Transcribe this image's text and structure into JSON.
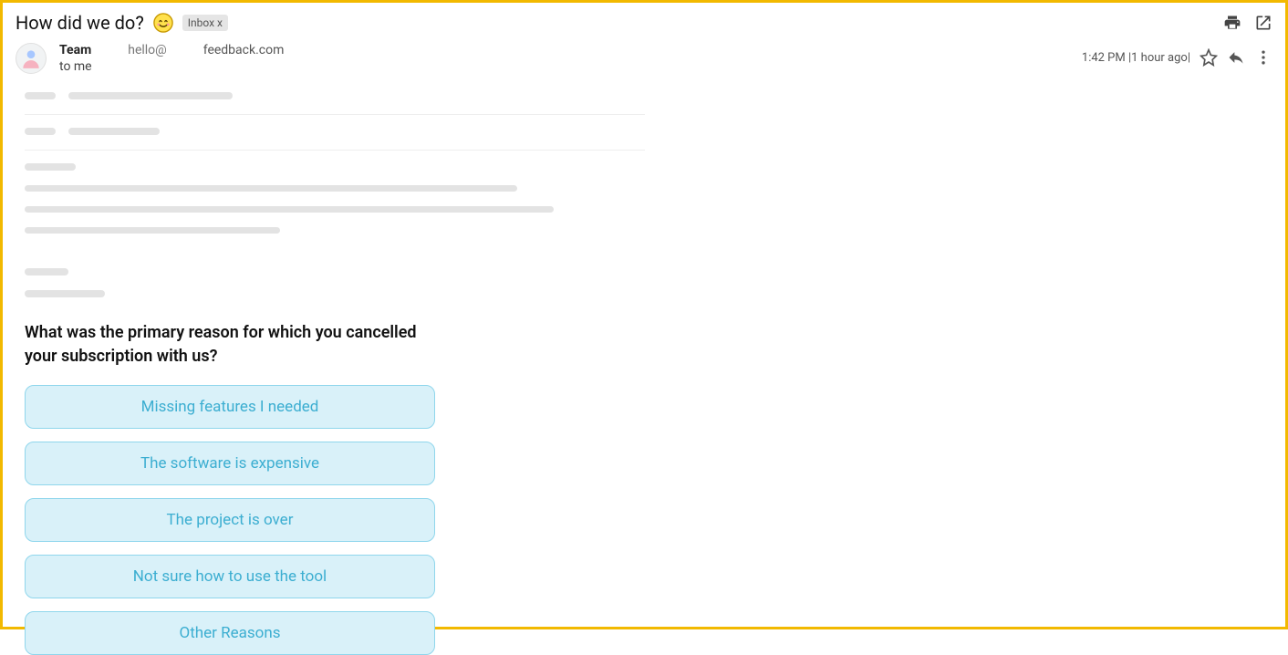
{
  "header": {
    "subject": "How did we do?",
    "label": "Inbox x"
  },
  "sender": {
    "name": "Team",
    "addr_user": "hello@",
    "addr_domain": "feedback.com",
    "to_line": "to me"
  },
  "meta": {
    "time": "1:42 PM |1 hour ago|"
  },
  "survey": {
    "question": "What was the primary reason for which you cancelled your subscription with us?",
    "options": [
      "Missing features I needed",
      "The software is expensive",
      "The project is over",
      "Not sure how to use the tool",
      "Other Reasons"
    ]
  }
}
